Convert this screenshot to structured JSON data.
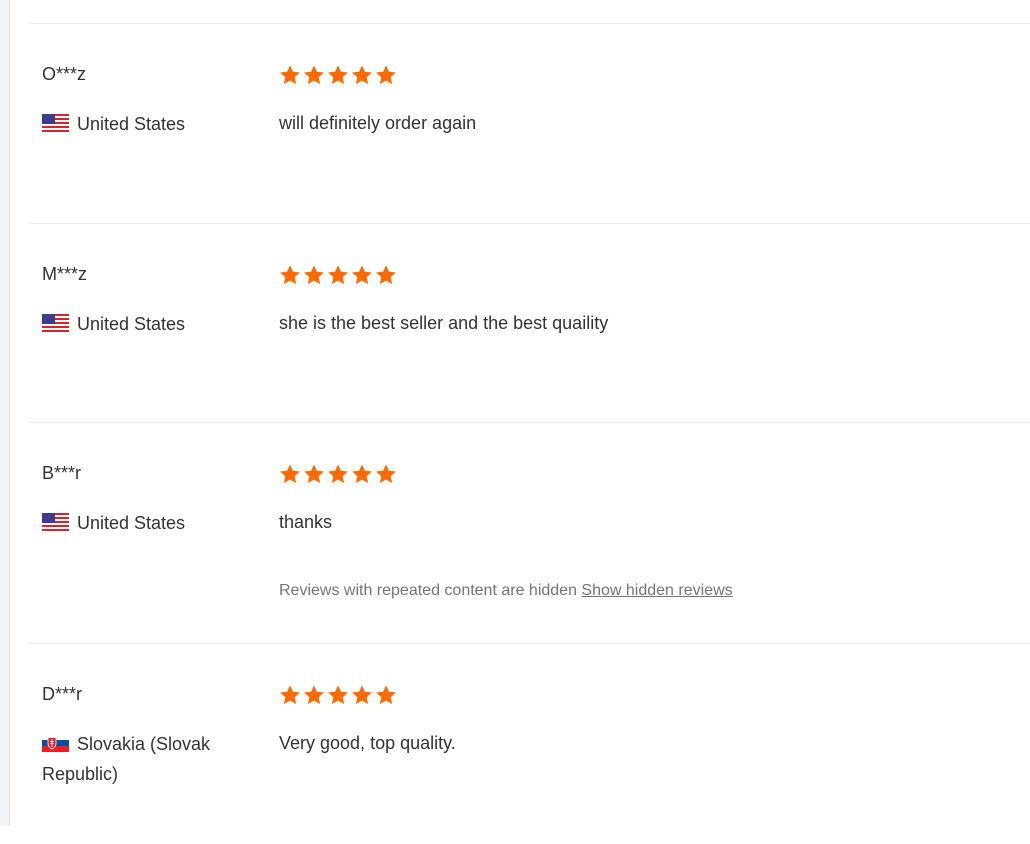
{
  "colors": {
    "star": "#ff6a00",
    "text": "#333333",
    "muted": "#757575",
    "divider": "#ececec"
  },
  "reviews": [
    {
      "buyer": "O***z",
      "country": "United States",
      "flag": "us-flag-icon",
      "rating": 5,
      "text": "will definitely order again"
    },
    {
      "buyer": "M***z",
      "country": "United States",
      "flag": "us-flag-icon",
      "rating": 5,
      "text": "she is the best seller and the best quaility"
    },
    {
      "buyer": "B***r",
      "country": "United States",
      "flag": "us-flag-icon",
      "rating": 5,
      "text": "thanks",
      "hidden_note": "Reviews with repeated content are hidden",
      "hidden_link": "Show hidden reviews"
    },
    {
      "buyer": "D***r",
      "country": "Slovakia (Slovak Republic)",
      "flag": "slovakia-flag-icon",
      "rating": 5,
      "text": "Very good, top quality."
    }
  ]
}
